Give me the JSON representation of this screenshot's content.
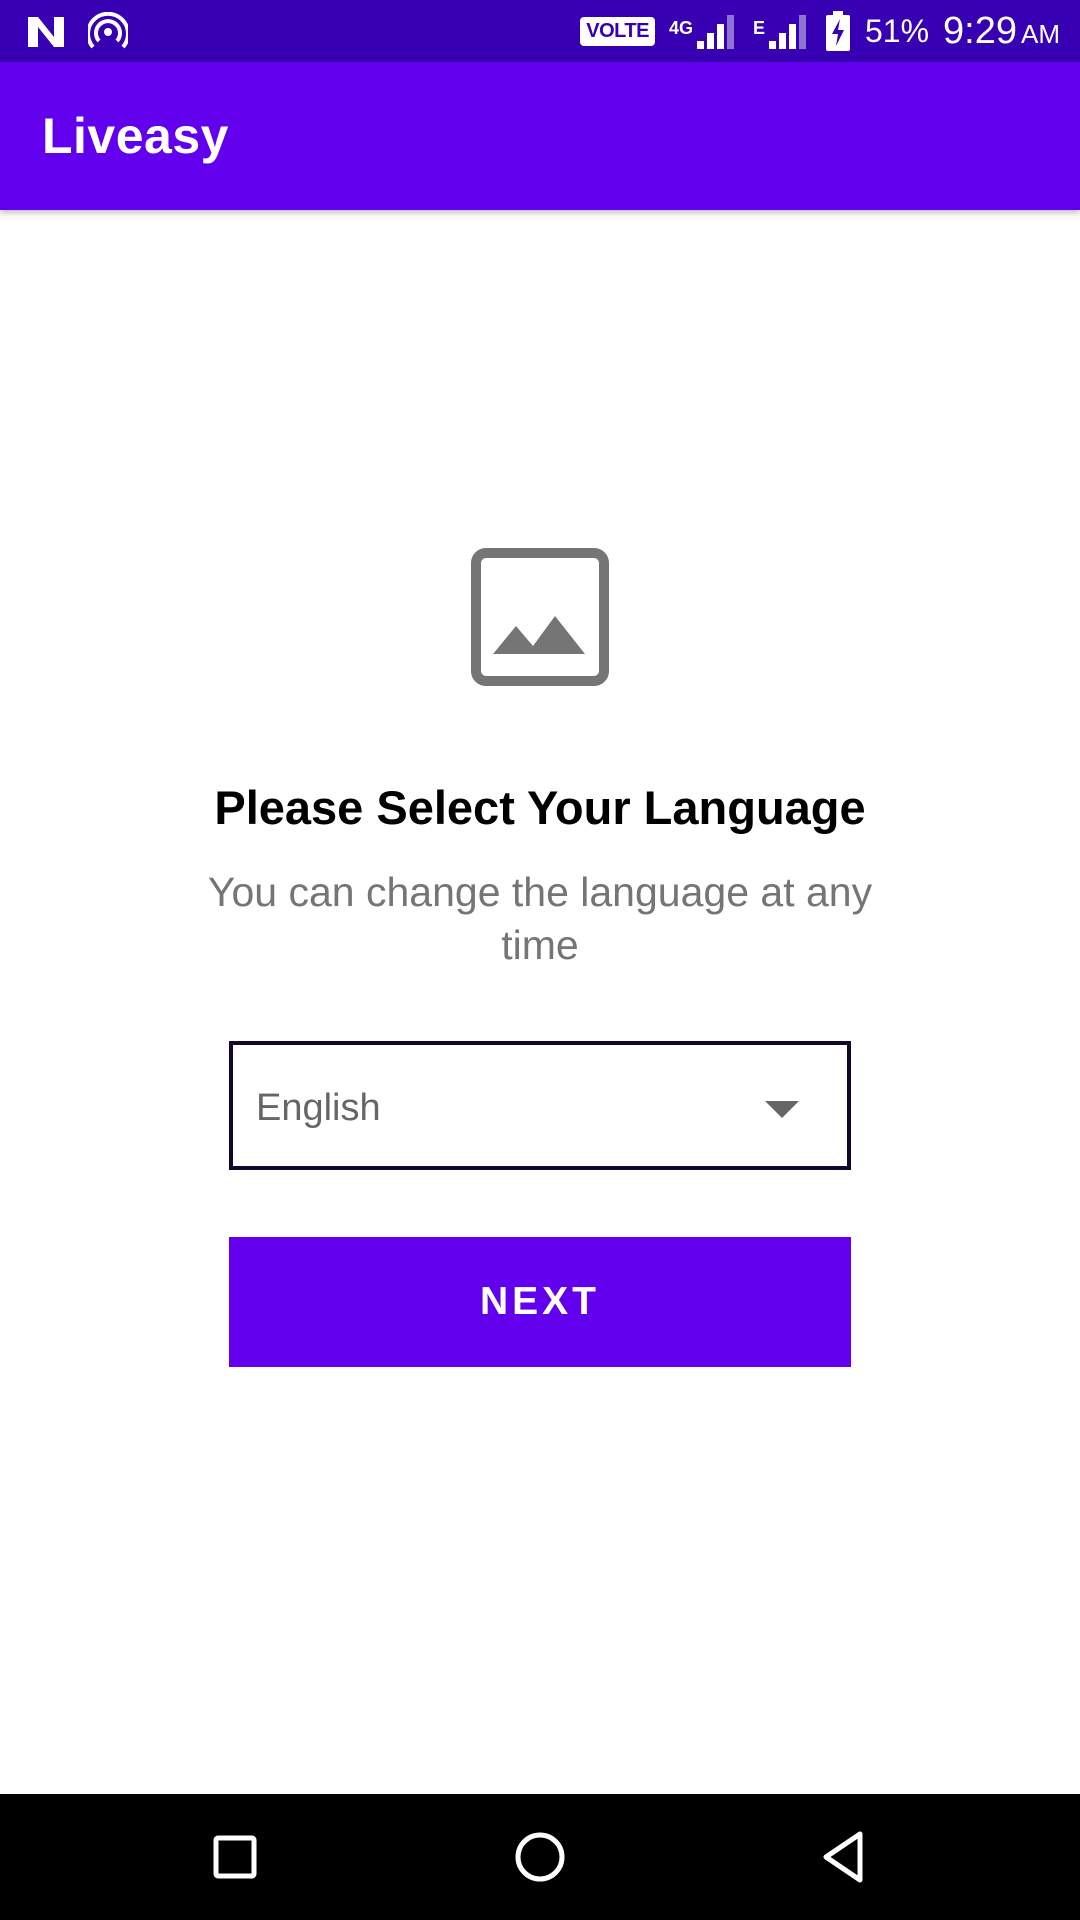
{
  "status_bar": {
    "left_icons": [
      "n-logo-icon",
      "hotspot-icon"
    ],
    "volte": "VOLTE",
    "network_1": "4G",
    "network_2": "E",
    "battery": "51%",
    "time": "9:29",
    "ampm": "AM"
  },
  "app_bar": {
    "title": "Liveasy",
    "color": "#6200ee"
  },
  "main": {
    "image_icon": "image-placeholder-icon",
    "heading": "Please Select Your Language",
    "subheading": "You can change the language at any time",
    "language_select": {
      "selected": "English"
    },
    "next_label": "NEXT"
  },
  "nav_bar": {
    "buttons": [
      "recents-square-icon",
      "home-circle-icon",
      "back-triangle-icon"
    ]
  },
  "colors": {
    "status_bar": "#3700b3",
    "primary": "#6200ee",
    "subtitle_text": "#757575"
  }
}
